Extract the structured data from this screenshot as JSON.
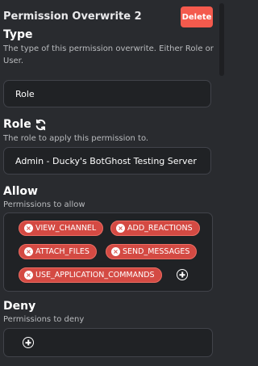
{
  "header": {
    "title": "Permission Overwrite 2",
    "delete_label": "Delete"
  },
  "type_section": {
    "title": "Type",
    "description": "The type of this permission overwrite. Either Role or User.",
    "value": "Role"
  },
  "role_section": {
    "title": "Role",
    "description": "The role to apply this permission to.",
    "value": "Admin - Ducky's BotGhost Testing Server"
  },
  "allow_section": {
    "title": "Allow",
    "description": "Permissions to allow",
    "tags": [
      "VIEW_CHANNEL",
      "ADD_REACTIONS",
      "ATTACH_FILES",
      "SEND_MESSAGES",
      "USE_APPLICATION_COMMANDS"
    ]
  },
  "deny_section": {
    "title": "Deny",
    "description": "Permissions to deny",
    "tags": []
  },
  "colors": {
    "background": "#292b2f",
    "input_background": "#202225",
    "delete_button": "#f45a4d",
    "tag": "#d44a43"
  },
  "icons": {
    "refresh": "refresh-icon",
    "add": "plus-circle-icon",
    "remove": "close-circle-icon"
  }
}
